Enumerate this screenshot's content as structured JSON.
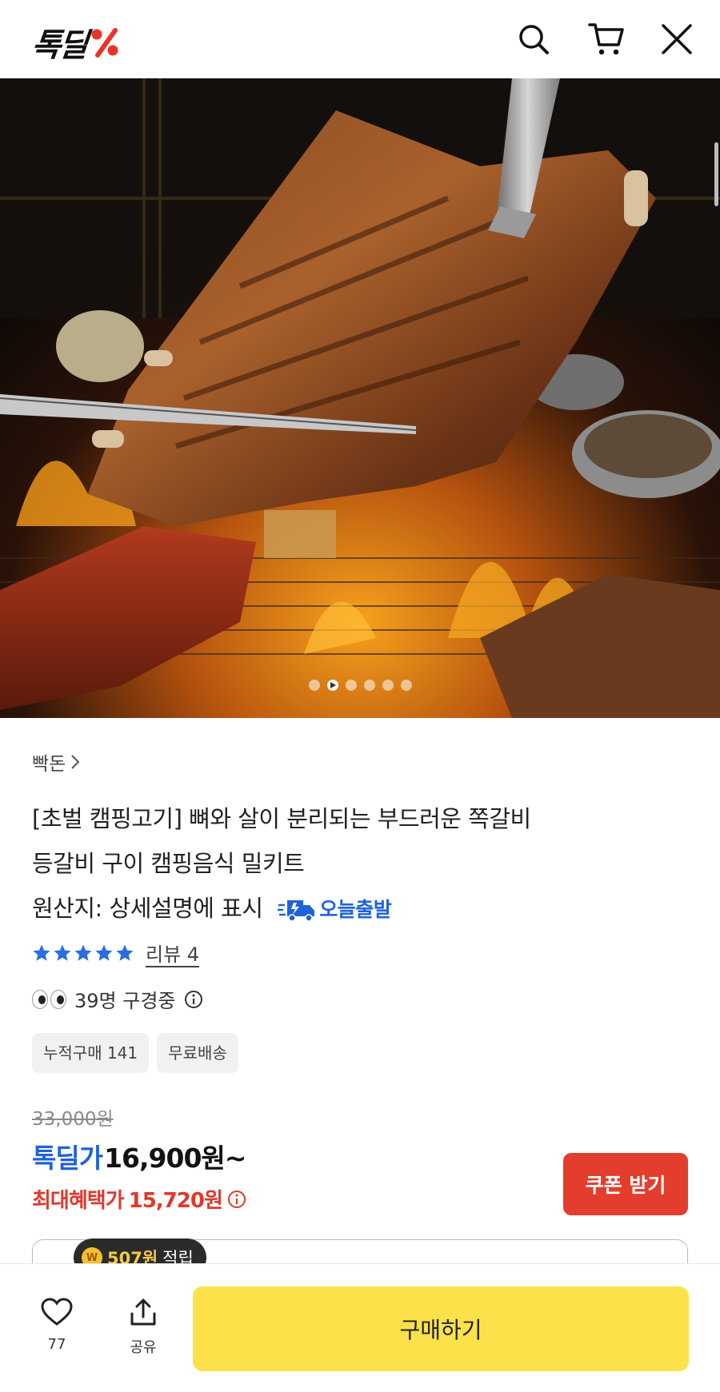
{
  "header": {
    "logo_text": "톡딜",
    "icons": [
      "search-icon",
      "cart-icon",
      "close-icon"
    ]
  },
  "hero": {
    "slide_count": 6,
    "active_slide": 2
  },
  "product": {
    "breadcrumb": "빡돈",
    "title_line1": "[초벌 캠핑고기] 뼈와 살이 분리되는 부드러운 쪽갈비",
    "title_line2": "등갈비 구이 캠핑음식 밀키트",
    "title_line3": "원산지: 상세설명에 표시",
    "delivery_badge": "오늘출발",
    "rating_stars": 5,
    "review_link": "리뷰 4",
    "viewers_text": "39명 구경중",
    "tags": [
      "누적구매 141",
      "무료배송"
    ],
    "original_price": "33,000원",
    "price_label": "톡딜가",
    "price_value": "16,900원~",
    "benefit_label": "최대혜택가",
    "benefit_value": "15,720원",
    "coupon_button": "쿠폰 받기"
  },
  "colors": {
    "accent_blue": "#1f63d9",
    "accent_red": "#e33d2d",
    "buy_yellow": "#fbe24b"
  },
  "bottom_bar": {
    "reward_coin": "W",
    "reward_amount": "507원",
    "reward_suffix": "적립",
    "like_count": "77",
    "share_label": "공유",
    "buy_button": "구매하기"
  }
}
